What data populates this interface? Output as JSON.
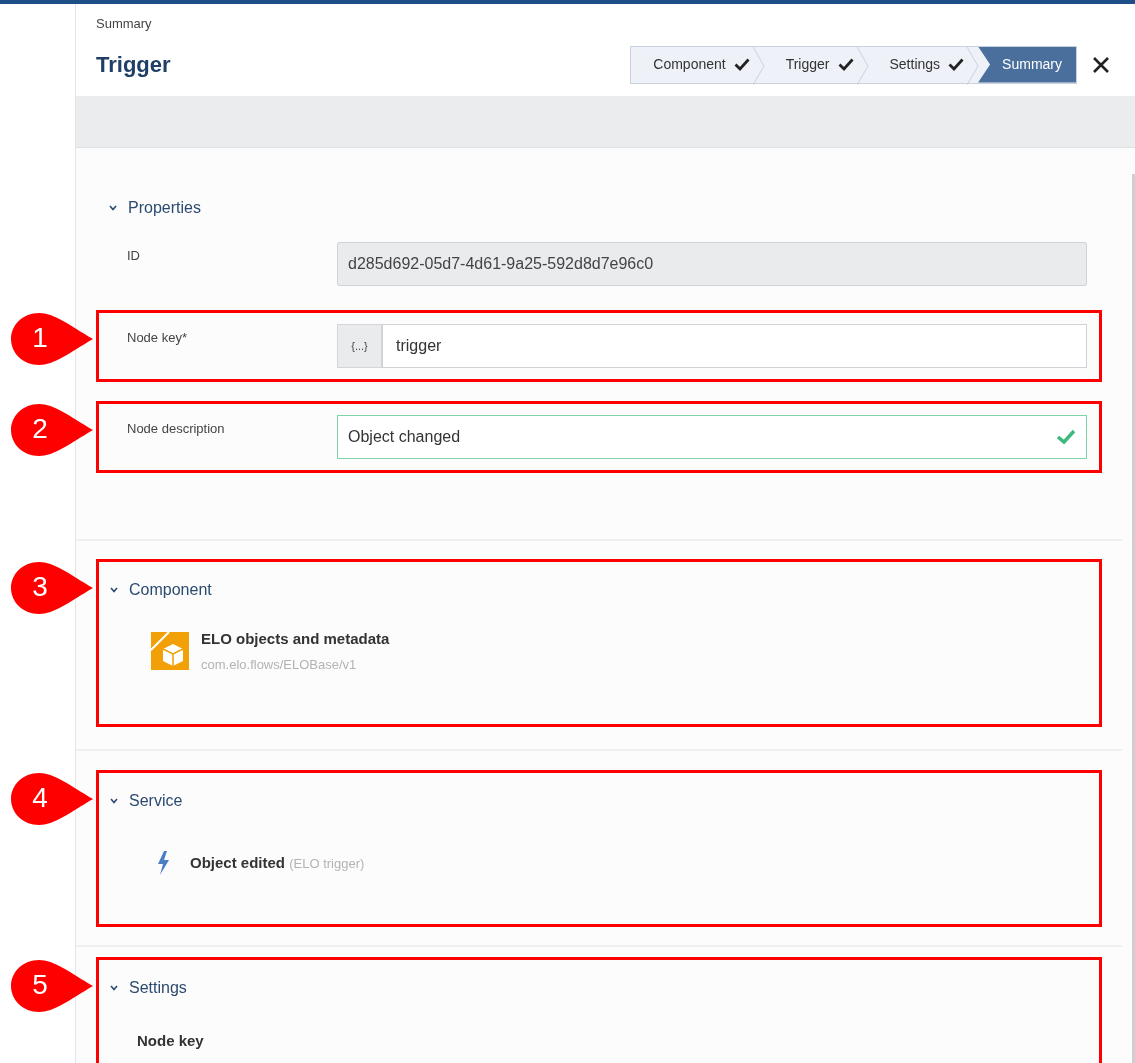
{
  "header": {
    "breadcrumb": "Summary",
    "title": "Trigger"
  },
  "steps": [
    {
      "label": "Component",
      "done": true,
      "selected": false
    },
    {
      "label": "Trigger",
      "done": true,
      "selected": false
    },
    {
      "label": "Settings",
      "done": true,
      "selected": false
    },
    {
      "label": "Summary",
      "done": false,
      "selected": true
    }
  ],
  "sections": [
    {
      "kind": "properties",
      "title": "Properties",
      "expanded": true,
      "fields": [
        {
          "kind": "readonly",
          "label": "ID",
          "value": "d285d692-05d7-4d61-9a25-592d8d7e96c0"
        },
        {
          "kind": "expression",
          "label": "Node key*",
          "prefix": "{...}",
          "value": "trigger",
          "callout": "1"
        },
        {
          "kind": "text",
          "label": "Node description",
          "value": "Object changed",
          "valid": true,
          "callout": "2"
        }
      ]
    },
    {
      "kind": "component",
      "title": "Component",
      "expanded": true,
      "callout": "3",
      "name": "ELO objects and metadata",
      "path": "com.elo.flows/ELOBase/v1"
    },
    {
      "kind": "service",
      "title": "Service",
      "expanded": true,
      "callout": "4",
      "name": "Object edited",
      "detail": "(ELO trigger)"
    },
    {
      "kind": "settings",
      "title": "Settings",
      "expanded": true,
      "callout": "5",
      "items": [
        "Node key"
      ]
    }
  ]
}
